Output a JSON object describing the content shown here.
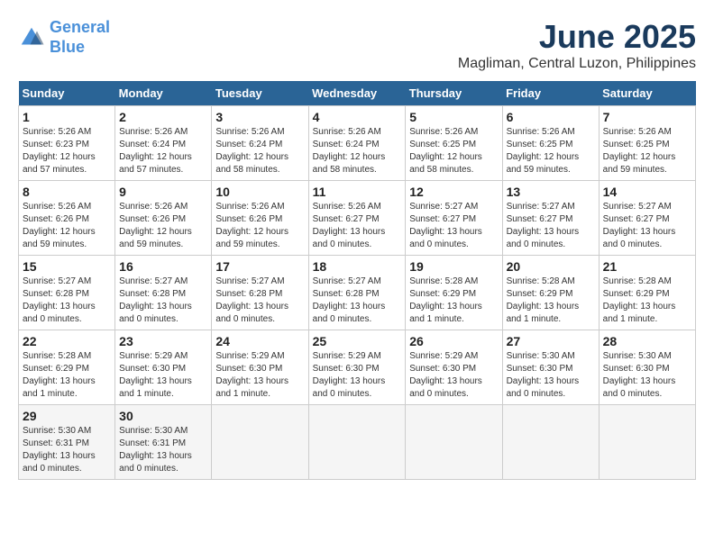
{
  "header": {
    "logo_line1": "General",
    "logo_line2": "Blue",
    "month_year": "June 2025",
    "location": "Magliman, Central Luzon, Philippines"
  },
  "columns": [
    "Sunday",
    "Monday",
    "Tuesday",
    "Wednesday",
    "Thursday",
    "Friday",
    "Saturday"
  ],
  "weeks": [
    [
      {
        "day": "1",
        "info": "Sunrise: 5:26 AM\nSunset: 6:23 PM\nDaylight: 12 hours and 57 minutes."
      },
      {
        "day": "2",
        "info": "Sunrise: 5:26 AM\nSunset: 6:24 PM\nDaylight: 12 hours and 57 minutes."
      },
      {
        "day": "3",
        "info": "Sunrise: 5:26 AM\nSunset: 6:24 PM\nDaylight: 12 hours and 58 minutes."
      },
      {
        "day": "4",
        "info": "Sunrise: 5:26 AM\nSunset: 6:24 PM\nDaylight: 12 hours and 58 minutes."
      },
      {
        "day": "5",
        "info": "Sunrise: 5:26 AM\nSunset: 6:25 PM\nDaylight: 12 hours and 58 minutes."
      },
      {
        "day": "6",
        "info": "Sunrise: 5:26 AM\nSunset: 6:25 PM\nDaylight: 12 hours and 59 minutes."
      },
      {
        "day": "7",
        "info": "Sunrise: 5:26 AM\nSunset: 6:25 PM\nDaylight: 12 hours and 59 minutes."
      }
    ],
    [
      {
        "day": "8",
        "info": "Sunrise: 5:26 AM\nSunset: 6:26 PM\nDaylight: 12 hours and 59 minutes."
      },
      {
        "day": "9",
        "info": "Sunrise: 5:26 AM\nSunset: 6:26 PM\nDaylight: 12 hours and 59 minutes."
      },
      {
        "day": "10",
        "info": "Sunrise: 5:26 AM\nSunset: 6:26 PM\nDaylight: 12 hours and 59 minutes."
      },
      {
        "day": "11",
        "info": "Sunrise: 5:26 AM\nSunset: 6:27 PM\nDaylight: 13 hours and 0 minutes."
      },
      {
        "day": "12",
        "info": "Sunrise: 5:27 AM\nSunset: 6:27 PM\nDaylight: 13 hours and 0 minutes."
      },
      {
        "day": "13",
        "info": "Sunrise: 5:27 AM\nSunset: 6:27 PM\nDaylight: 13 hours and 0 minutes."
      },
      {
        "day": "14",
        "info": "Sunrise: 5:27 AM\nSunset: 6:27 PM\nDaylight: 13 hours and 0 minutes."
      }
    ],
    [
      {
        "day": "15",
        "info": "Sunrise: 5:27 AM\nSunset: 6:28 PM\nDaylight: 13 hours and 0 minutes."
      },
      {
        "day": "16",
        "info": "Sunrise: 5:27 AM\nSunset: 6:28 PM\nDaylight: 13 hours and 0 minutes."
      },
      {
        "day": "17",
        "info": "Sunrise: 5:27 AM\nSunset: 6:28 PM\nDaylight: 13 hours and 0 minutes."
      },
      {
        "day": "18",
        "info": "Sunrise: 5:27 AM\nSunset: 6:28 PM\nDaylight: 13 hours and 0 minutes."
      },
      {
        "day": "19",
        "info": "Sunrise: 5:28 AM\nSunset: 6:29 PM\nDaylight: 13 hours and 1 minute."
      },
      {
        "day": "20",
        "info": "Sunrise: 5:28 AM\nSunset: 6:29 PM\nDaylight: 13 hours and 1 minute."
      },
      {
        "day": "21",
        "info": "Sunrise: 5:28 AM\nSunset: 6:29 PM\nDaylight: 13 hours and 1 minute."
      }
    ],
    [
      {
        "day": "22",
        "info": "Sunrise: 5:28 AM\nSunset: 6:29 PM\nDaylight: 13 hours and 1 minute."
      },
      {
        "day": "23",
        "info": "Sunrise: 5:29 AM\nSunset: 6:30 PM\nDaylight: 13 hours and 1 minute."
      },
      {
        "day": "24",
        "info": "Sunrise: 5:29 AM\nSunset: 6:30 PM\nDaylight: 13 hours and 1 minute."
      },
      {
        "day": "25",
        "info": "Sunrise: 5:29 AM\nSunset: 6:30 PM\nDaylight: 13 hours and 0 minutes."
      },
      {
        "day": "26",
        "info": "Sunrise: 5:29 AM\nSunset: 6:30 PM\nDaylight: 13 hours and 0 minutes."
      },
      {
        "day": "27",
        "info": "Sunrise: 5:30 AM\nSunset: 6:30 PM\nDaylight: 13 hours and 0 minutes."
      },
      {
        "day": "28",
        "info": "Sunrise: 5:30 AM\nSunset: 6:30 PM\nDaylight: 13 hours and 0 minutes."
      }
    ],
    [
      {
        "day": "29",
        "info": "Sunrise: 5:30 AM\nSunset: 6:31 PM\nDaylight: 13 hours and 0 minutes."
      },
      {
        "day": "30",
        "info": "Sunrise: 5:30 AM\nSunset: 6:31 PM\nDaylight: 13 hours and 0 minutes."
      },
      {
        "day": "",
        "info": ""
      },
      {
        "day": "",
        "info": ""
      },
      {
        "day": "",
        "info": ""
      },
      {
        "day": "",
        "info": ""
      },
      {
        "day": "",
        "info": ""
      }
    ]
  ]
}
